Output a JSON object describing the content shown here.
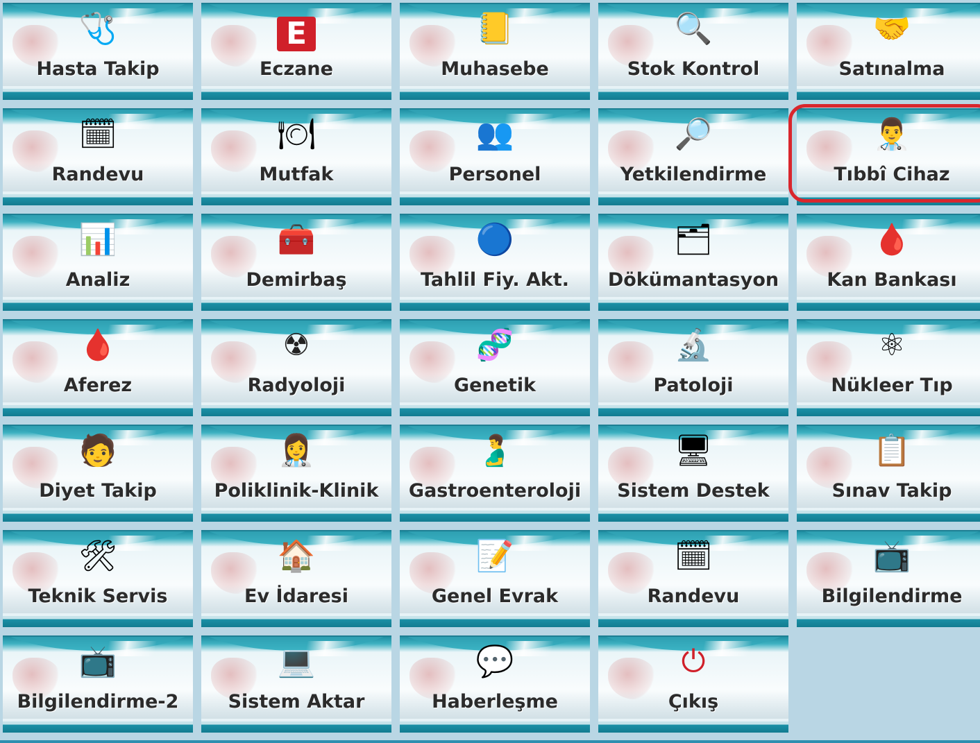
{
  "tiles": [
    {
      "label": "Hasta Takip",
      "icon": "nurse-hat-icon",
      "glyph": "🩺"
    },
    {
      "label": "Eczane",
      "icon": "pharmacy-e-icon",
      "glyph": "E"
    },
    {
      "label": "Muhasebe",
      "icon": "accounting-book-icon",
      "glyph": "📒"
    },
    {
      "label": "Stok Kontrol",
      "icon": "magnifier-stock-icon",
      "glyph": "🔍"
    },
    {
      "label": "Satınalma",
      "icon": "handshake-icon",
      "glyph": "🤝"
    },
    {
      "label": "Randevu",
      "icon": "calendar-clock-icon",
      "glyph": "🗓"
    },
    {
      "label": "Mutfak",
      "icon": "plate-fork-knife-icon",
      "glyph": "🍽"
    },
    {
      "label": "Personel",
      "icon": "people-group-icon",
      "glyph": "👥"
    },
    {
      "label": "Yetkilendirme",
      "icon": "user-search-icon",
      "glyph": "🔎"
    },
    {
      "label": "Tıbbî Cihaz",
      "icon": "doctor-device-icon",
      "glyph": "👨‍⚕"
    },
    {
      "label": "Analiz",
      "icon": "bar-chart-icon",
      "glyph": "📊"
    },
    {
      "label": "Demirbaş",
      "icon": "inventory-tool-icon",
      "glyph": "🧰"
    },
    {
      "label": "Tahlil Fiy. Akt.",
      "icon": "lab-refresh-icon",
      "glyph": "🔵"
    },
    {
      "label": "Dökümantasyon",
      "icon": "folder-docs-icon",
      "glyph": "🗂"
    },
    {
      "label": "Kan Bankası",
      "icon": "blood-bag-heart-icon",
      "glyph": "🩸"
    },
    {
      "label": "Aferez",
      "icon": "blood-bag-icon",
      "glyph": "🩸"
    },
    {
      "label": "Radyoloji",
      "icon": "radiation-icon",
      "glyph": "☢"
    },
    {
      "label": "Genetik",
      "icon": "dna-icon",
      "glyph": "🧬"
    },
    {
      "label": "Patoloji",
      "icon": "pathology-icon",
      "glyph": "🔬"
    },
    {
      "label": "Nükleer Tıp",
      "icon": "nuclear-medicine-icon",
      "glyph": "⚛"
    },
    {
      "label": "Diyet Takip",
      "icon": "diet-user-icon",
      "glyph": "🧑"
    },
    {
      "label": "Poliklinik-Klinik",
      "icon": "doctors-icon",
      "glyph": "👩‍⚕"
    },
    {
      "label": "Gastroenteroloji",
      "icon": "stomach-icon",
      "glyph": "🫃"
    },
    {
      "label": "Sistem Destek",
      "icon": "support-user-computer-icon",
      "glyph": "🖥"
    },
    {
      "label": "Sınav Takip",
      "icon": "clipboard-check-icon",
      "glyph": "📋"
    },
    {
      "label": "Teknik Servis",
      "icon": "technician-icon",
      "glyph": "🛠"
    },
    {
      "label": "Ev İdaresi",
      "icon": "house-refresh-icon",
      "glyph": "🏠"
    },
    {
      "label": "Genel Evrak",
      "icon": "document-pen-icon",
      "glyph": "📝"
    },
    {
      "label": "Randevu",
      "icon": "calendar-clock-icon",
      "glyph": "🗓"
    },
    {
      "label": "Bilgilendirme",
      "icon": "presentation-board-icon",
      "glyph": "📺"
    },
    {
      "label": "Bilgilendirme-2",
      "icon": "presentation-board-icon",
      "glyph": "📺"
    },
    {
      "label": "Sistem Aktar",
      "icon": "transfer-computer-icon",
      "glyph": "💻"
    },
    {
      "label": "Haberleşme",
      "icon": "chat-bubbles-icon",
      "glyph": "💬"
    },
    {
      "label": "Çıkış",
      "icon": "power-icon",
      "glyph": "⏻"
    }
  ],
  "highlighted_tile": "Tıbbî Cihaz",
  "colors": {
    "accent": "#1b90a6",
    "highlight": "#d9262d",
    "background": "#b9d6e4"
  }
}
